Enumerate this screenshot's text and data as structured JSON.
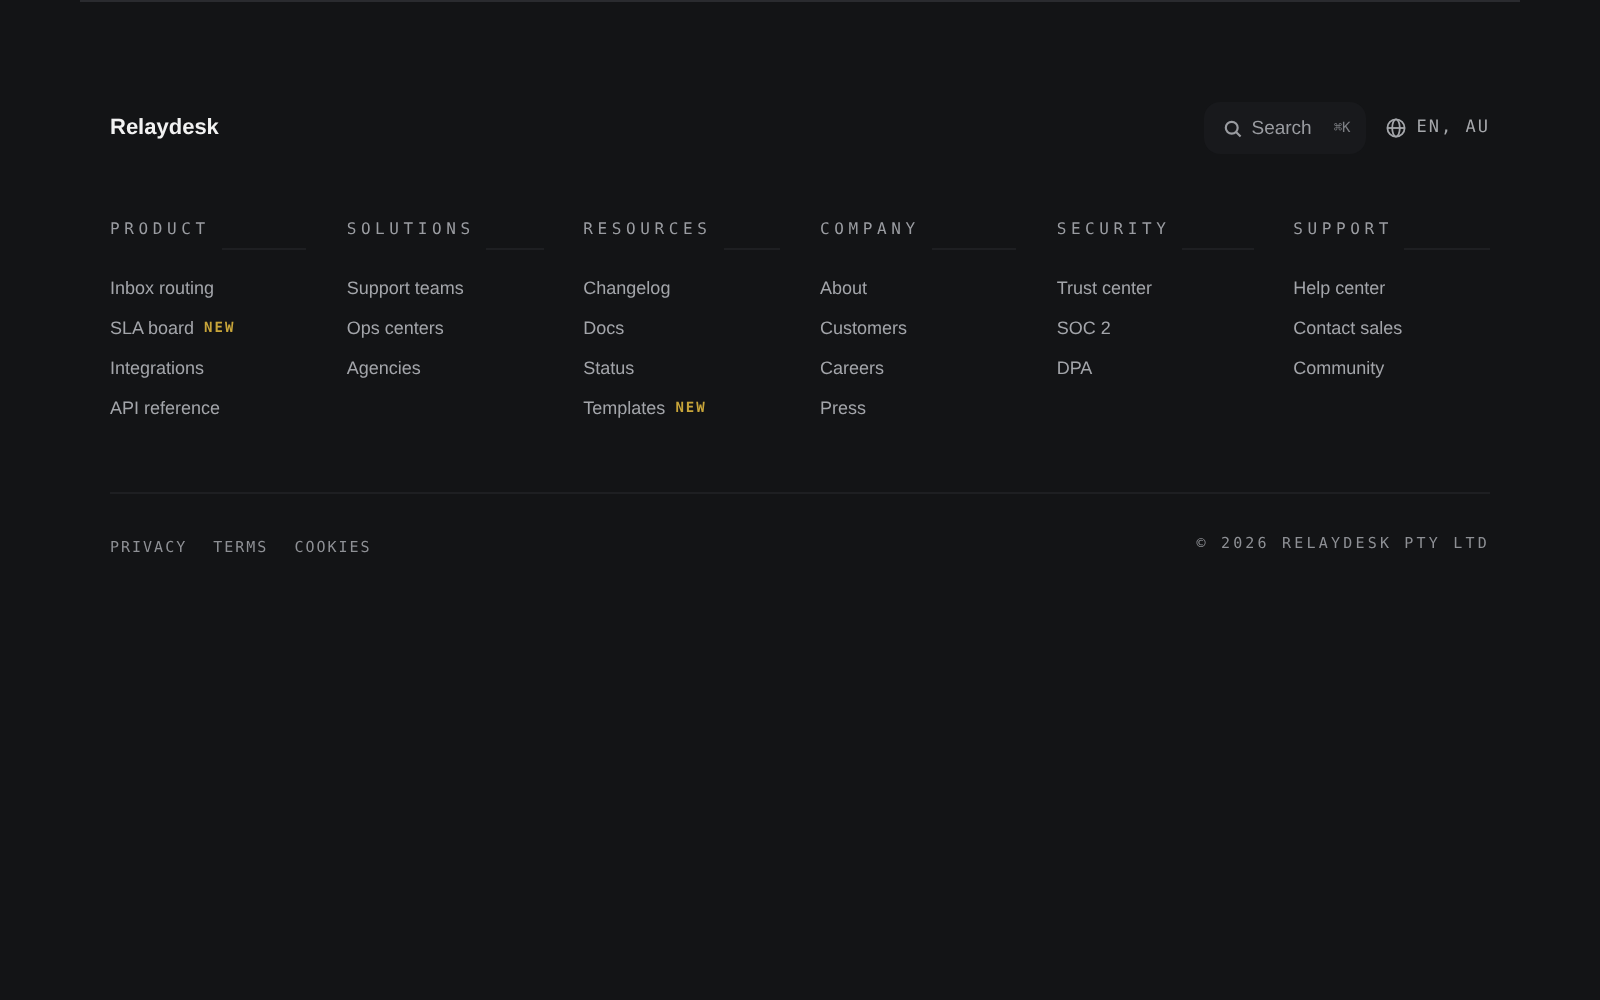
{
  "brand": "Relaydesk",
  "search": {
    "label": "Search",
    "shortcut": "⌘K"
  },
  "locale": "EN, AU",
  "columns": [
    {
      "heading": "PRODUCT",
      "links": [
        {
          "label": "Inbox routing"
        },
        {
          "label": "SLA board",
          "badge": "NEW"
        },
        {
          "label": "Integrations"
        },
        {
          "label": "API reference"
        }
      ]
    },
    {
      "heading": "SOLUTIONS",
      "links": [
        {
          "label": "Support teams"
        },
        {
          "label": "Ops centers"
        },
        {
          "label": "Agencies"
        }
      ]
    },
    {
      "heading": "RESOURCES",
      "links": [
        {
          "label": "Changelog"
        },
        {
          "label": "Docs"
        },
        {
          "label": "Status"
        },
        {
          "label": "Templates",
          "badge": "NEW"
        }
      ]
    },
    {
      "heading": "COMPANY",
      "links": [
        {
          "label": "About"
        },
        {
          "label": "Customers"
        },
        {
          "label": "Careers"
        },
        {
          "label": "Press"
        }
      ]
    },
    {
      "heading": "SECURITY",
      "links": [
        {
          "label": "Trust center"
        },
        {
          "label": "SOC 2"
        },
        {
          "label": "DPA"
        }
      ]
    },
    {
      "heading": "SUPPORT",
      "links": [
        {
          "label": "Help center"
        },
        {
          "label": "Contact sales"
        },
        {
          "label": "Community"
        }
      ]
    }
  ],
  "legal_links": [
    "PRIVACY",
    "TERMS",
    "COOKIES"
  ],
  "copyright": "© 2026 RELAYDESK PTY LTD"
}
